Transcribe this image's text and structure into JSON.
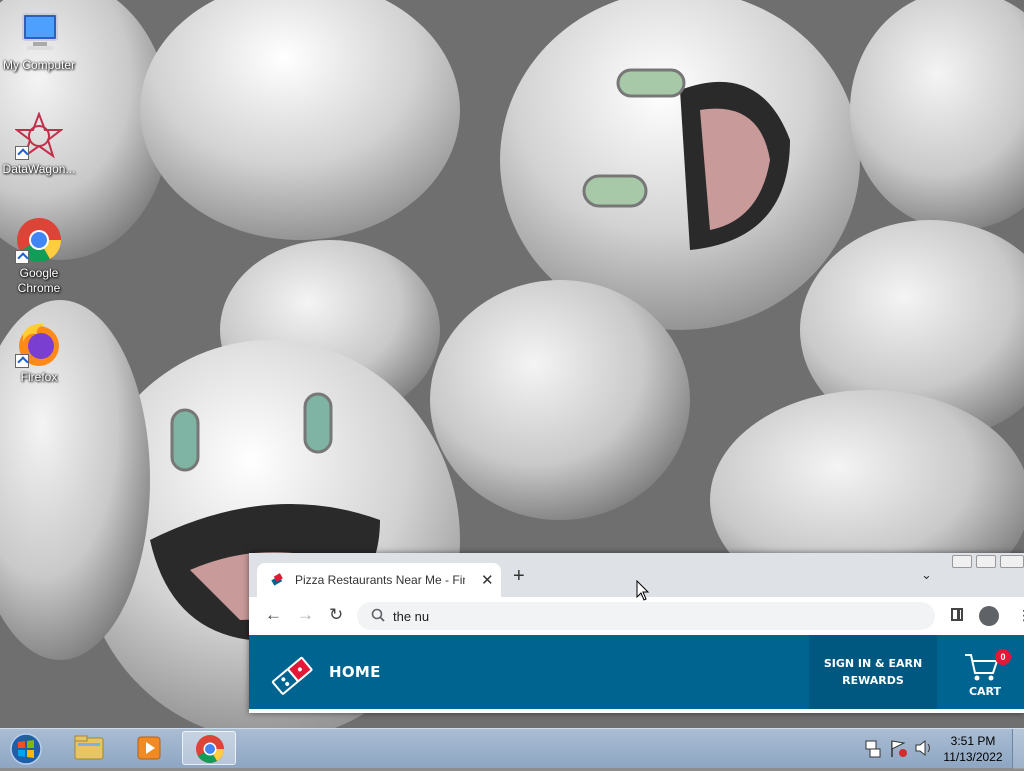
{
  "desktop": {
    "icons": [
      {
        "label": "My Computer"
      },
      {
        "label": "DataWagon..."
      },
      {
        "label": "Google Chrome"
      },
      {
        "label": "Firefox"
      }
    ]
  },
  "browser": {
    "tab": {
      "title": "Pizza Restaurants Near Me - Find",
      "close_glyph": "✕"
    },
    "new_tab_glyph": "+",
    "tab_search_glyph": "⌄",
    "nav": {
      "back": "←",
      "forward": "→",
      "reload": "↻",
      "menu": "⋮"
    },
    "omnibox": {
      "value": "the nu"
    }
  },
  "site": {
    "brand_color": "#006491",
    "nav": {
      "home": "HOME",
      "signin_line1": "SIGN IN & EARN",
      "signin_line2": "REWARDS",
      "cart_label": "CART",
      "cart_count": "0"
    }
  },
  "taskbar": {
    "items": [
      "start-orb",
      "file-explorer",
      "media-player",
      "chrome"
    ],
    "clock": {
      "time": "3:51 PM",
      "date": "11/13/2022"
    }
  }
}
